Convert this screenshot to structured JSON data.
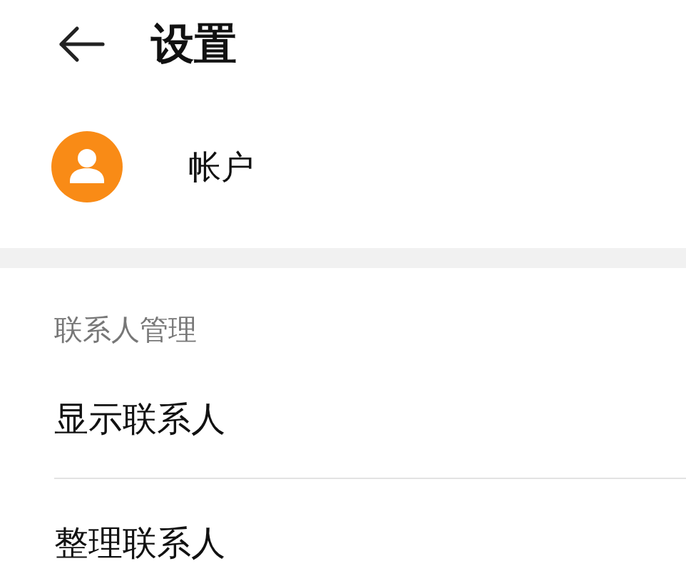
{
  "header": {
    "title": "设置"
  },
  "account": {
    "label": "帐户"
  },
  "section": {
    "title": "联系人管理",
    "items": [
      {
        "label": "显示联系人"
      },
      {
        "label": "整理联系人"
      }
    ]
  }
}
